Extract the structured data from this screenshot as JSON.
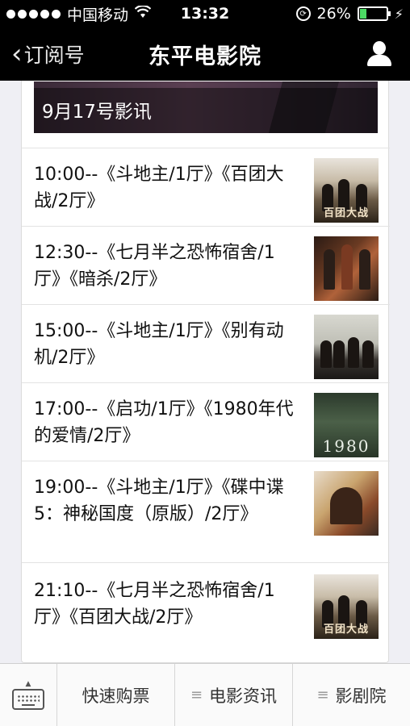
{
  "status": {
    "carrier": "中国移动",
    "time": "13:32",
    "battery_text": "26%",
    "battery_level": 0.26,
    "signal_bars": 5,
    "signal_filled": 5
  },
  "nav": {
    "back_label": "订阅号",
    "title": "东平电影院"
  },
  "banner": {
    "title": "9月17号影讯"
  },
  "schedule": [
    {
      "text": "10:00--《斗地主/1厅》《百团大战/2厅》",
      "poster": "war-poster",
      "poster_title": "百团大战"
    },
    {
      "text": "12:30--《七月半之恐怖宿舍/1厅》《暗杀/2厅》",
      "poster": "assassination-poster"
    },
    {
      "text": "15:00--《斗地主/1厅》《别有动机/2厅》",
      "poster": "motive-poster"
    },
    {
      "text": "17:00--《启功/1厅》《1980年代的爱情/2厅》",
      "poster": "1980-poster",
      "poster_title": "1980"
    },
    {
      "text": "19:00--《斗地主/1厅》《碟中谍5：神秘国度（原版）/2厅》",
      "poster": "mission-impossible-poster"
    },
    {
      "text": "21:10--《七月半之恐怖宿舍/1厅》《百团大战/2厅》",
      "poster": "war-poster",
      "poster_title": "百团大战"
    }
  ],
  "tabbar": {
    "buy": "快速购票",
    "news": "电影资讯",
    "theater": "影剧院"
  },
  "icons": {
    "signal": "signal-dots-icon",
    "wifi": "wifi-icon",
    "lock": "rotation-lock-icon",
    "battery": "battery-icon",
    "charging": "charging-bolt-icon",
    "back": "chevron-left-icon",
    "profile": "person-icon",
    "keyboard": "keyboard-icon",
    "menu": "menu-lines-icon"
  },
  "colors": {
    "bar": "#000000",
    "battery_fill": "#4cd964",
    "background": "#efeff4"
  }
}
